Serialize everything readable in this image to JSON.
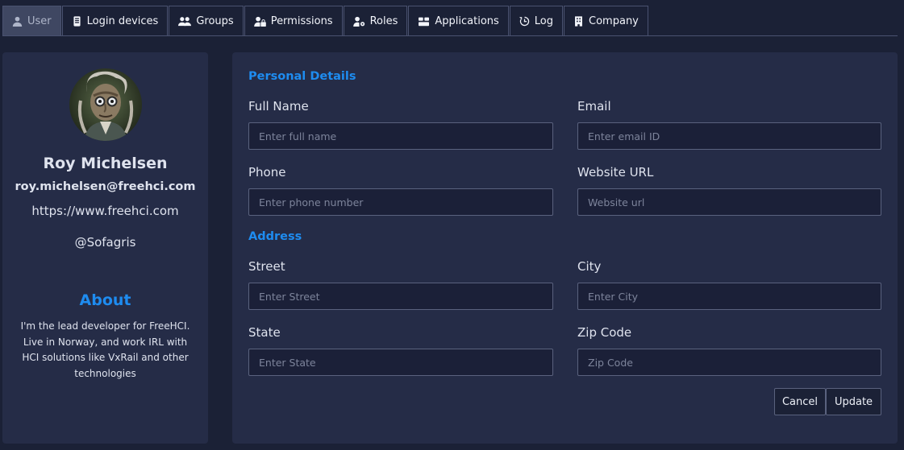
{
  "tabs": [
    {
      "label": "User",
      "icon": "user-icon",
      "active": true
    },
    {
      "label": "Login devices",
      "icon": "device-icon",
      "active": false
    },
    {
      "label": "Groups",
      "icon": "users-icon",
      "active": false
    },
    {
      "label": "Permissions",
      "icon": "user-lock-icon",
      "active": false
    },
    {
      "label": "Roles",
      "icon": "user-gear-icon",
      "active": false
    },
    {
      "label": "Applications",
      "icon": "boxes-icon",
      "active": false
    },
    {
      "label": "Log",
      "icon": "history-icon",
      "active": false
    },
    {
      "label": "Company",
      "icon": "building-icon",
      "active": false
    }
  ],
  "profile": {
    "name": "Roy Michelsen",
    "email": "roy.michelsen@freehci.com",
    "website": "https://www.freehci.com",
    "handle": "@Sofagris",
    "about_title": "About",
    "about_text": "I'm the lead developer for FreeHCI. Live in Norway, and work IRL with HCI solutions like VxRail and other technologies"
  },
  "form": {
    "personal_title": "Personal Details",
    "address_title": "Address",
    "full_name": {
      "label": "Full Name",
      "placeholder": "Enter full name",
      "value": ""
    },
    "email": {
      "label": "Email",
      "placeholder": "Enter email ID",
      "value": ""
    },
    "phone": {
      "label": "Phone",
      "placeholder": "Enter phone number",
      "value": ""
    },
    "website": {
      "label": "Website URL",
      "placeholder": "Website url",
      "value": ""
    },
    "street": {
      "label": "Street",
      "placeholder": "Enter Street",
      "value": ""
    },
    "city": {
      "label": "City",
      "placeholder": "Enter City",
      "value": ""
    },
    "state": {
      "label": "State",
      "placeholder": "Enter State",
      "value": ""
    },
    "zip": {
      "label": "Zip Code",
      "placeholder": "Zip Code",
      "value": ""
    },
    "cancel_label": "Cancel",
    "update_label": "Update"
  },
  "colors": {
    "accent": "#1e8cf0",
    "background": "#1b2136",
    "card": "#252c47",
    "active_tab": "#3f4762"
  }
}
